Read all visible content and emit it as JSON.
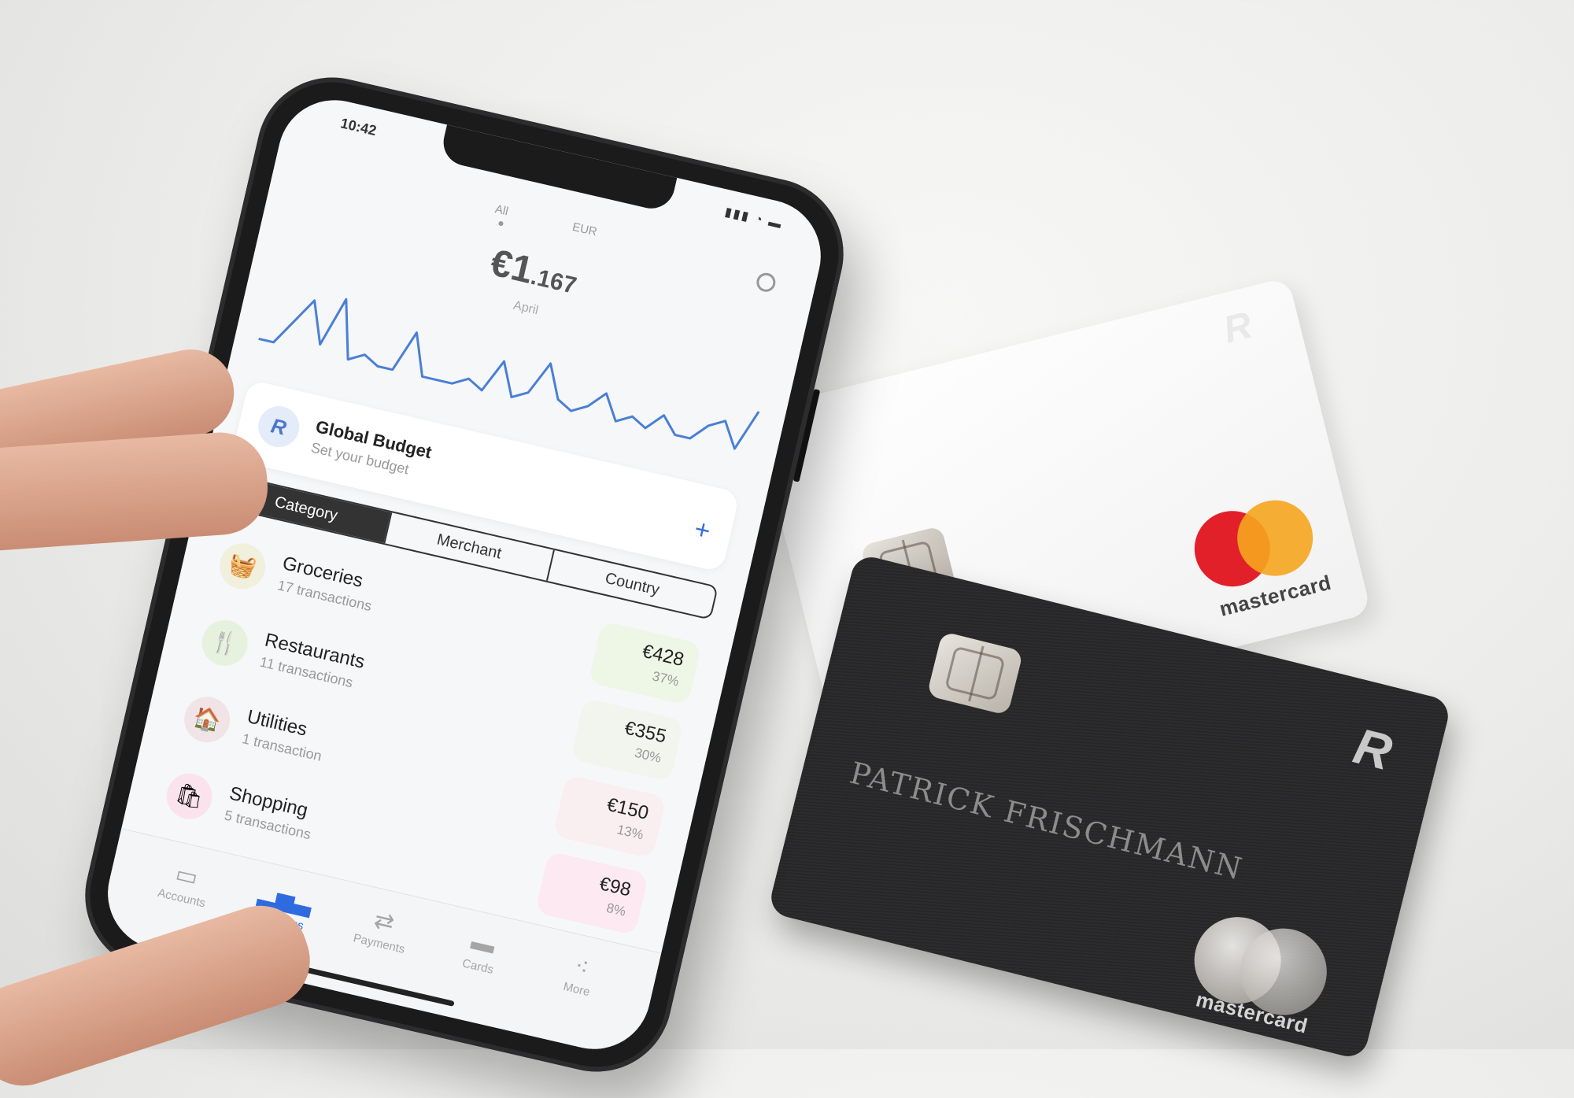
{
  "status": {
    "time": "10:42",
    "icons": "▮▮▮ ◔ ▬"
  },
  "top_tabs": [
    "All",
    "EUR"
  ],
  "summary": {
    "amount_main": "€1",
    "amount_decimal": ".167",
    "period": "April"
  },
  "graph": {
    "type": "line",
    "color": "#4a7fd6",
    "values": [
      2,
      2,
      5,
      8,
      3,
      9,
      2,
      3,
      2,
      2,
      7,
      2,
      2,
      2,
      3,
      2,
      6,
      2,
      3,
      7,
      3,
      2,
      3,
      5,
      2,
      3,
      2,
      4,
      2,
      2,
      4,
      5,
      2,
      7
    ]
  },
  "budget": {
    "title": "Global Budget",
    "subtitle": "Set your budget",
    "add_label": "+"
  },
  "segments": [
    "Category",
    "Merchant",
    "Country"
  ],
  "categories": [
    {
      "name": "Groceries",
      "count": "17 transactions",
      "amount": "€428",
      "percent": "37%",
      "icon": "🧺",
      "icon_bg": "#f0f0dc",
      "box_bg": "#eef6e6"
    },
    {
      "name": "Restaurants",
      "count": "11 transactions",
      "amount": "€355",
      "percent": "30%",
      "icon": "🍴",
      "icon_bg": "#e6f2dd",
      "box_bg": "#f1f5ee"
    },
    {
      "name": "Utilities",
      "count": "1 transaction",
      "amount": "€150",
      "percent": "13%",
      "icon": "🏠",
      "icon_bg": "#f1e4e6",
      "box_bg": "#f9eef0"
    },
    {
      "name": "Shopping",
      "count": "5 transactions",
      "amount": "€98",
      "percent": "8%",
      "icon": "🛍",
      "icon_bg": "#fbe3ee",
      "box_bg": "#fce9f1"
    }
  ],
  "tabbar": [
    {
      "label": "Accounts",
      "icon": "▭",
      "active": false
    },
    {
      "label": "Analytics",
      "icon": "▂▅▃",
      "active": true
    },
    {
      "label": "Payments",
      "icon": "⇄",
      "active": false
    },
    {
      "label": "Cards",
      "icon": "▬",
      "active": false
    },
    {
      "label": "More",
      "icon": "⁖",
      "active": false
    }
  ],
  "cards": {
    "white": {
      "brand": "mastercard",
      "logo": "R"
    },
    "black": {
      "holder": "PATRICK FRISCHMANN",
      "brand": "mastercard",
      "logo": "R"
    }
  },
  "colors": {
    "accent": "#2f6be0",
    "mc_red": "#e2202a",
    "mc_yellow": "#f6a51e"
  }
}
